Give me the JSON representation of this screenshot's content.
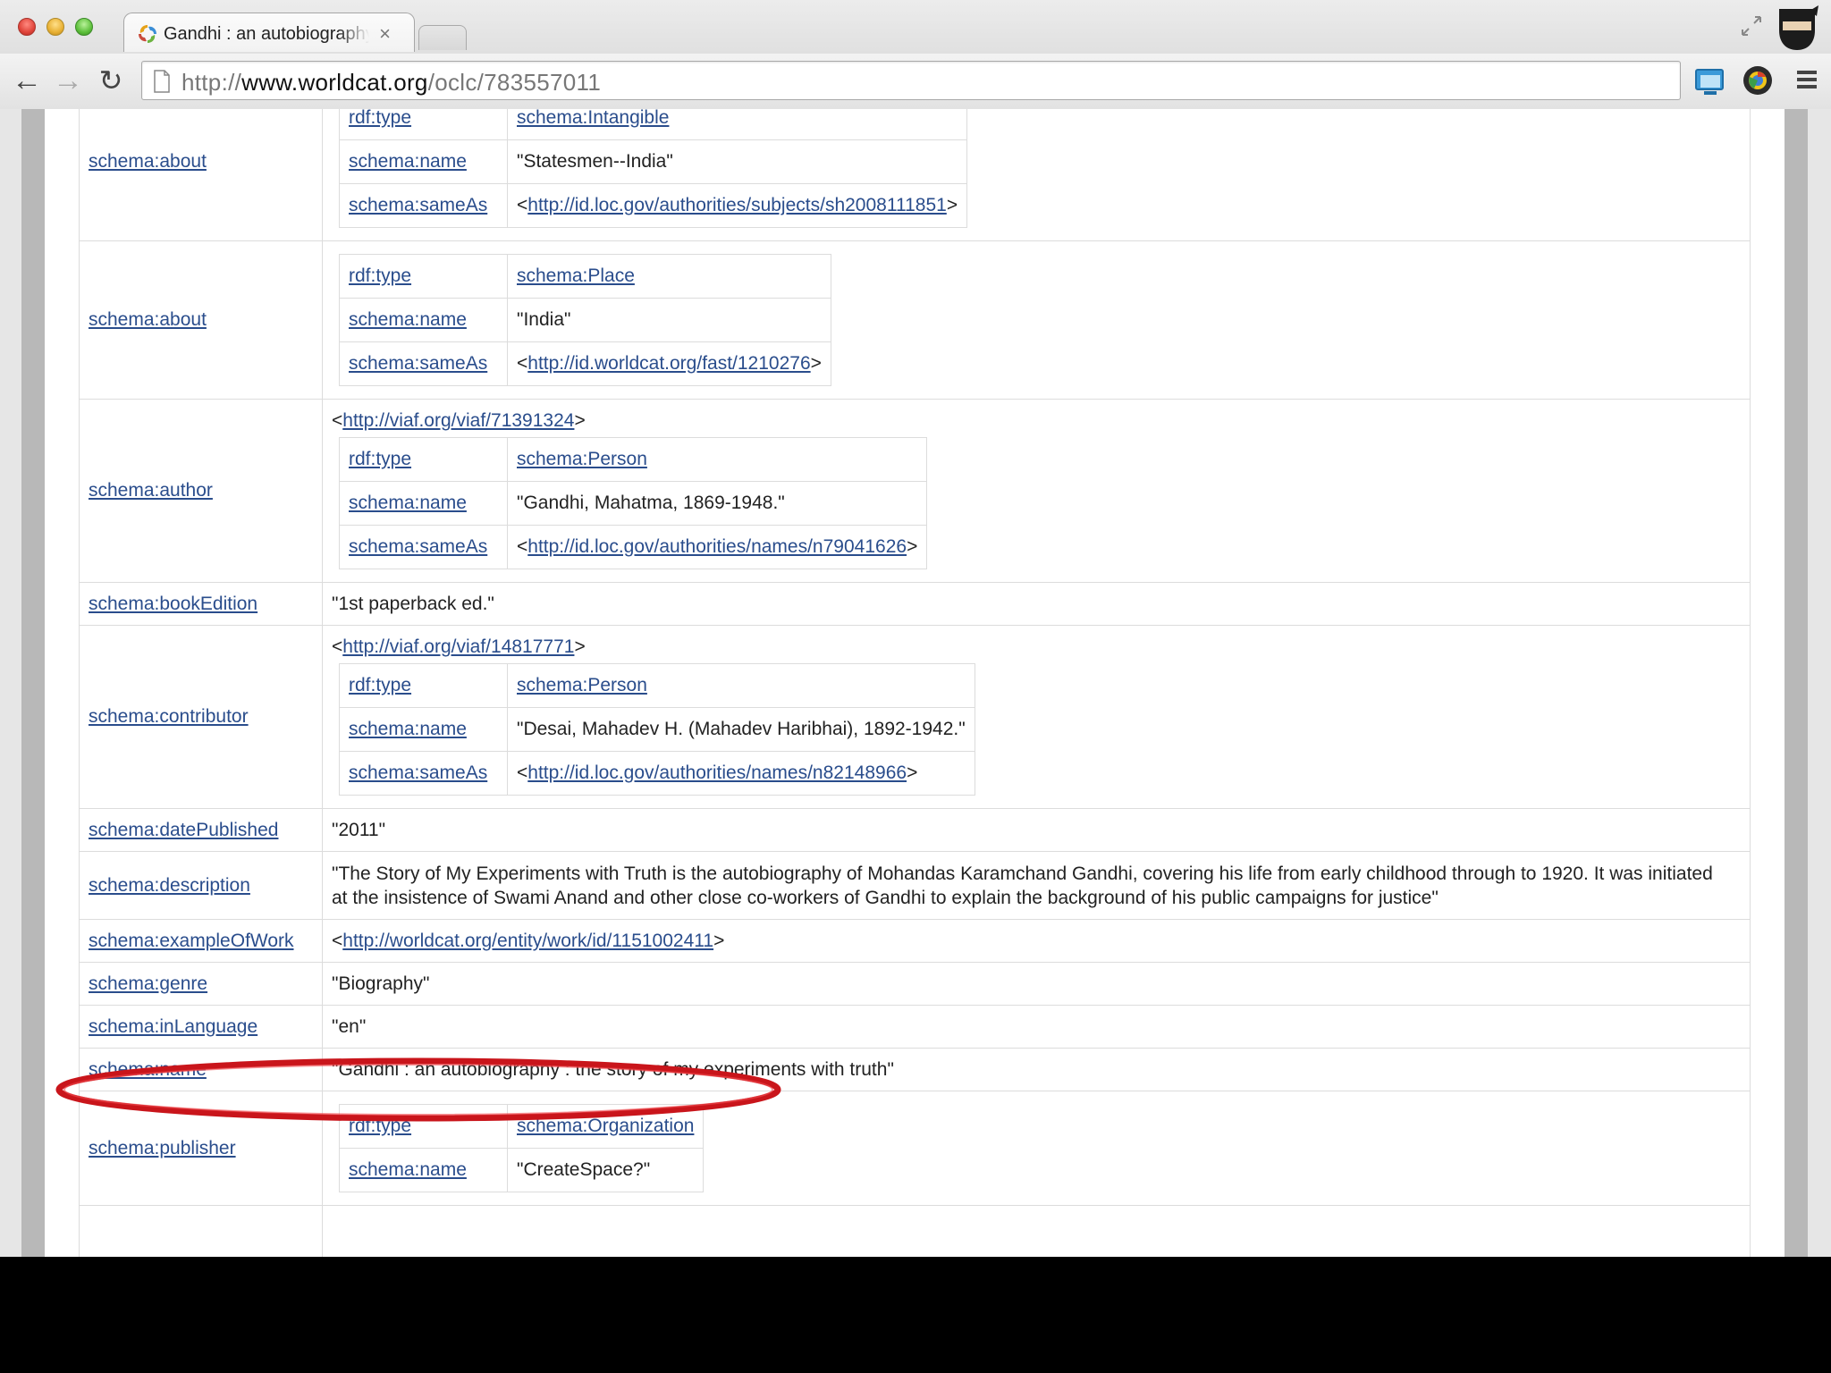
{
  "browser": {
    "tab_title": "Gandhi : an autobiography : the story of my experiments with truth",
    "tab_close": "×",
    "url_scheme": "http://",
    "url_host": "www.worldcat.org",
    "url_path": "/oclc/783557011"
  },
  "rows": [
    {
      "key": "schema:about",
      "inner": [
        [
          "rdf:type",
          "schema:Intangible",
          "link"
        ],
        [
          "schema:name",
          "\"Statesmen--India\"",
          "text"
        ],
        [
          "schema:sameAs",
          "http://id.loc.gov/authorities/subjects/sh2008111851",
          "uri"
        ]
      ]
    },
    {
      "key": "schema:about",
      "inner": [
        [
          "rdf:type",
          "schema:Place",
          "link"
        ],
        [
          "schema:name",
          "\"India\"",
          "text"
        ],
        [
          "schema:sameAs",
          "http://id.worldcat.org/fast/1210276",
          "uri"
        ]
      ]
    },
    {
      "key": "schema:author",
      "uri": "http://viaf.org/viaf/71391324",
      "inner": [
        [
          "rdf:type",
          "schema:Person",
          "link"
        ],
        [
          "schema:name",
          "\"Gandhi, Mahatma, 1869-1948.\"",
          "text"
        ],
        [
          "schema:sameAs",
          "http://id.loc.gov/authorities/names/n79041626",
          "uri"
        ]
      ]
    },
    {
      "key": "schema:bookEdition",
      "text": "\"1st paperback ed.\""
    },
    {
      "key": "schema:contributor",
      "uri": "http://viaf.org/viaf/14817771",
      "inner": [
        [
          "rdf:type",
          "schema:Person",
          "link"
        ],
        [
          "schema:name",
          "\"Desai, Mahadev H. (Mahadev Haribhai), 1892-1942.\"",
          "text"
        ],
        [
          "schema:sameAs",
          "http://id.loc.gov/authorities/names/n82148966",
          "uri"
        ]
      ]
    },
    {
      "key": "schema:datePublished",
      "text": "\"2011\""
    },
    {
      "key": "schema:description",
      "text": "\"The Story of My Experiments with Truth is the autobiography of Mohandas Karamchand Gandhi, covering his life from early childhood through to 1920. It was initiated at the insistence of Swami Anand and other close co-workers of Gandhi to explain the background of his public campaigns for justice\""
    },
    {
      "key": "schema:exampleOfWork",
      "uri_only": "http://worldcat.org/entity/work/id/1151002411"
    },
    {
      "key": "schema:genre",
      "text": "\"Biography\""
    },
    {
      "key": "schema:inLanguage",
      "text": "\"en\""
    },
    {
      "key": "schema:name",
      "text": "\"Gandhi : an autobiography : the story of my experiments with truth\""
    },
    {
      "key": "schema:publisher",
      "inner": [
        [
          "rdf:type",
          "schema:Organization",
          "link"
        ],
        [
          "schema:name",
          "\"CreateSpace?\"",
          "text"
        ]
      ]
    },
    {
      "key": "",
      "text": ""
    }
  ],
  "colors": {
    "link": "#2a4d8c",
    "highlight": "#e0141b",
    "border": "#dcdcdc"
  }
}
